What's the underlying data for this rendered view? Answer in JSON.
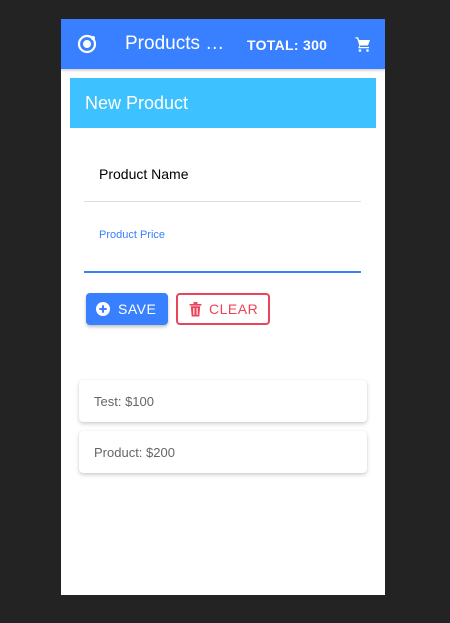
{
  "toolbar": {
    "title": "Products List",
    "total_label": "TOTAL: 300",
    "logo_icon": "ionic-logo-icon",
    "cart_icon": "cart-icon"
  },
  "card": {
    "header": "New Product"
  },
  "form": {
    "name_placeholder": "Product Name",
    "name_value": "",
    "price_label": "Product Price",
    "price_value": ""
  },
  "buttons": {
    "save_label": "Save",
    "save_icon": "add-circle-icon",
    "clear_label": "Clear",
    "clear_icon": "trash-icon"
  },
  "products": [
    {
      "label": "Test: $100"
    },
    {
      "label": "Product: $200"
    }
  ],
  "colors": {
    "primary": "#3880ff",
    "secondary": "#3dc2ff",
    "danger": "#eb445a",
    "background": "#232323"
  }
}
